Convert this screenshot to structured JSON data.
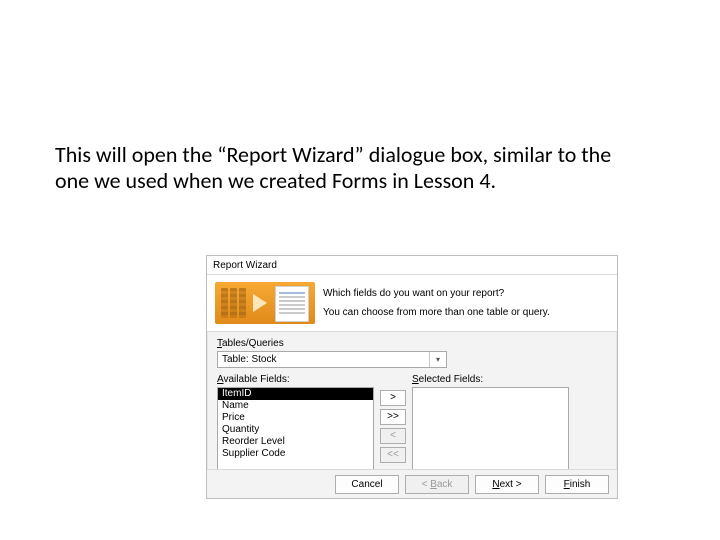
{
  "caption": "This will open the “Report Wizard” dialogue box, similar to the one we used when we created Forms in Lesson 4.",
  "dialog": {
    "title": "Report Wizard",
    "banner": {
      "question": "Which fields do you want on your report?",
      "sub": "You can choose from more than one table or query."
    },
    "tables_label_pre": "T",
    "tables_label_post": "ables/Queries",
    "combo": {
      "value": "Table: Stock"
    },
    "available_label_pre": "A",
    "available_label_post": "vailable Fields:",
    "selected_label_pre": "S",
    "selected_label_post": "elected Fields:",
    "available_items": [
      "ItemID",
      "Name",
      "Price",
      "Quantity",
      "Reorder Level",
      "Supplier Code"
    ],
    "selected_items": [],
    "move": {
      "add": ">",
      "add_all": ">>",
      "remove": "<",
      "remove_all": "<<"
    },
    "buttons": {
      "cancel": "Cancel",
      "back_pre": "< ",
      "back_u": "B",
      "back_post": "ack",
      "next_u": "N",
      "next_post": "ext >",
      "finish_u": "F",
      "finish_post": "inish"
    }
  }
}
